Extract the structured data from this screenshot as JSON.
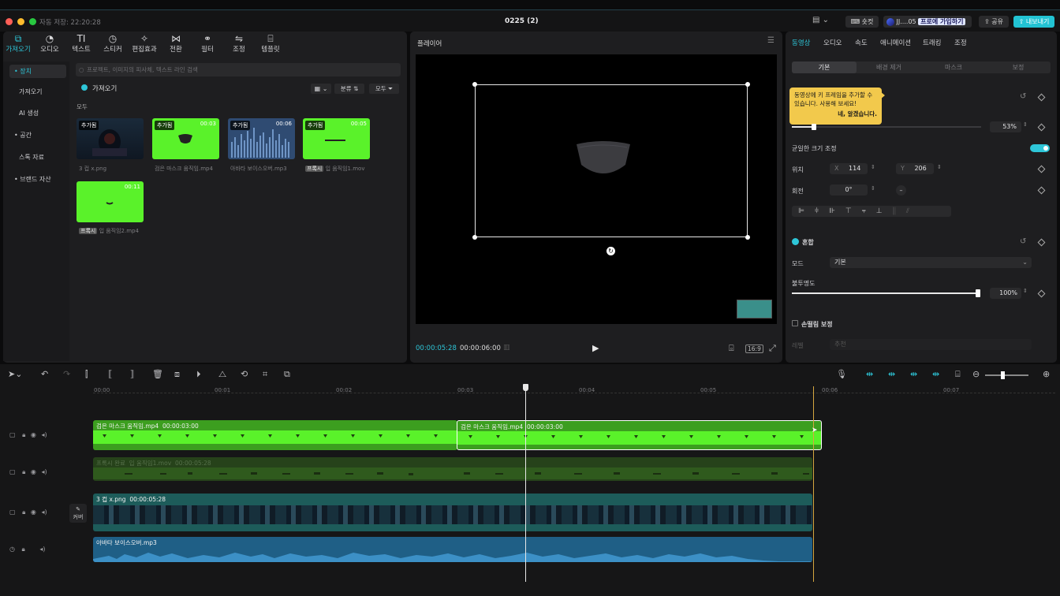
{
  "window": {
    "title": "0225 (2)",
    "autosave": "자동 저장: 22:20:28",
    "right_buttons": {
      "shortcut": "숏컷",
      "account": "JJ....05",
      "join_pro": "프로에 가입하기",
      "share": "공유",
      "export": "내보내기"
    }
  },
  "toolbar_tabs": [
    {
      "label": "가져오기",
      "icon": "import-icon"
    },
    {
      "label": "오디오",
      "icon": "audio-icon"
    },
    {
      "label": "텍스트",
      "icon": "text-icon"
    },
    {
      "label": "스티커",
      "icon": "sticker-icon"
    },
    {
      "label": "편집효과",
      "icon": "effects-icon"
    },
    {
      "label": "전환",
      "icon": "transition-icon"
    },
    {
      "label": "필터",
      "icon": "filter-icon"
    },
    {
      "label": "조정",
      "icon": "adjust-icon"
    },
    {
      "label": "템플릿",
      "icon": "template-icon"
    }
  ],
  "sidebar": [
    {
      "label": "• 장치"
    },
    {
      "label": "가져오기"
    },
    {
      "label": "AI 생성"
    },
    {
      "label": "• 공간"
    },
    {
      "label": "스톡 자료"
    },
    {
      "label": "• 브랜드 자산"
    }
  ],
  "media": {
    "search_placeholder": "프로젝트, 이미지의 피사체, 텍스트 라인 검색",
    "import_label": "가져오기",
    "sort_label": "분류",
    "all_label": "모두",
    "section_label": "모두",
    "items": [
      {
        "badge": "추가됨",
        "duration": "",
        "caption": "3 컵 x.png",
        "proxy": ""
      },
      {
        "badge": "추가됨",
        "duration": "00:03",
        "caption": "검은 마스크 움직임.mp4",
        "proxy": ""
      },
      {
        "badge": "추가됨",
        "duration": "00:06",
        "caption": "아바타 보이스오버.mp3",
        "proxy": ""
      },
      {
        "badge": "추가됨",
        "duration": "00:05",
        "caption": "입 움직임1.mov",
        "proxy": "프록시"
      },
      {
        "badge": "",
        "duration": "00:11",
        "caption": "입 움직임2.mp4",
        "proxy": "프록시"
      }
    ]
  },
  "player": {
    "title": "플레이어",
    "current_time": "00:00:05:28",
    "total_time": "00:00:06:00",
    "ratio": "16:9"
  },
  "inspector": {
    "tabs": [
      "동영상",
      "오디오",
      "속도",
      "애니메이션",
      "트래킹",
      "조정"
    ],
    "subtabs": [
      "기본",
      "배경 제거",
      "마스크",
      "보정"
    ],
    "tooltip": {
      "text": "동영상에 키 프레임을 추가할 수 있습니다. 사용해 보세요!",
      "confirm": "네, 알겠습니다."
    },
    "scale_value": "53%",
    "uniform_scale_label": "균일한 크기 조정",
    "position_label": "위치",
    "pos_x_label": "X",
    "pos_x": "114",
    "pos_y_label": "Y",
    "pos_y": "206",
    "rotation_label": "회전",
    "rotation": "0°",
    "blend_label": "혼합",
    "mode_label": "모드",
    "mode_value": "기본",
    "opacity_label": "불투명도",
    "opacity": "100%",
    "stabilize_label": "손떨림 보정",
    "level_label": "레벨",
    "level_value": "추천"
  },
  "timeline": {
    "ticks": [
      "00:00",
      "00:01",
      "00:02",
      "00:03",
      "00:04",
      "00:05",
      "00:06",
      "00:07"
    ],
    "cover_label": "커버",
    "clips": {
      "mask1": {
        "name": "검은 마스크 움직임.mp4",
        "duration": "00:00:03:00"
      },
      "mask2": {
        "name": "검은 마스크 움직임.mp4",
        "duration": "00:00:03:00"
      },
      "mouth": {
        "proxy": "프록시 완료",
        "name": "입 움직임1.mov",
        "duration": "00:00:05:28"
      },
      "image": {
        "name": "3 컵 x.png",
        "duration": "00:00:05:28"
      },
      "audio": {
        "name": "아바타 보이스오버.mp3"
      }
    }
  },
  "colors": {
    "accent": "#2ec6d8",
    "green_screen": "#5af22a",
    "audio": "#1f5f86",
    "image_track": "#1d5c5a"
  }
}
